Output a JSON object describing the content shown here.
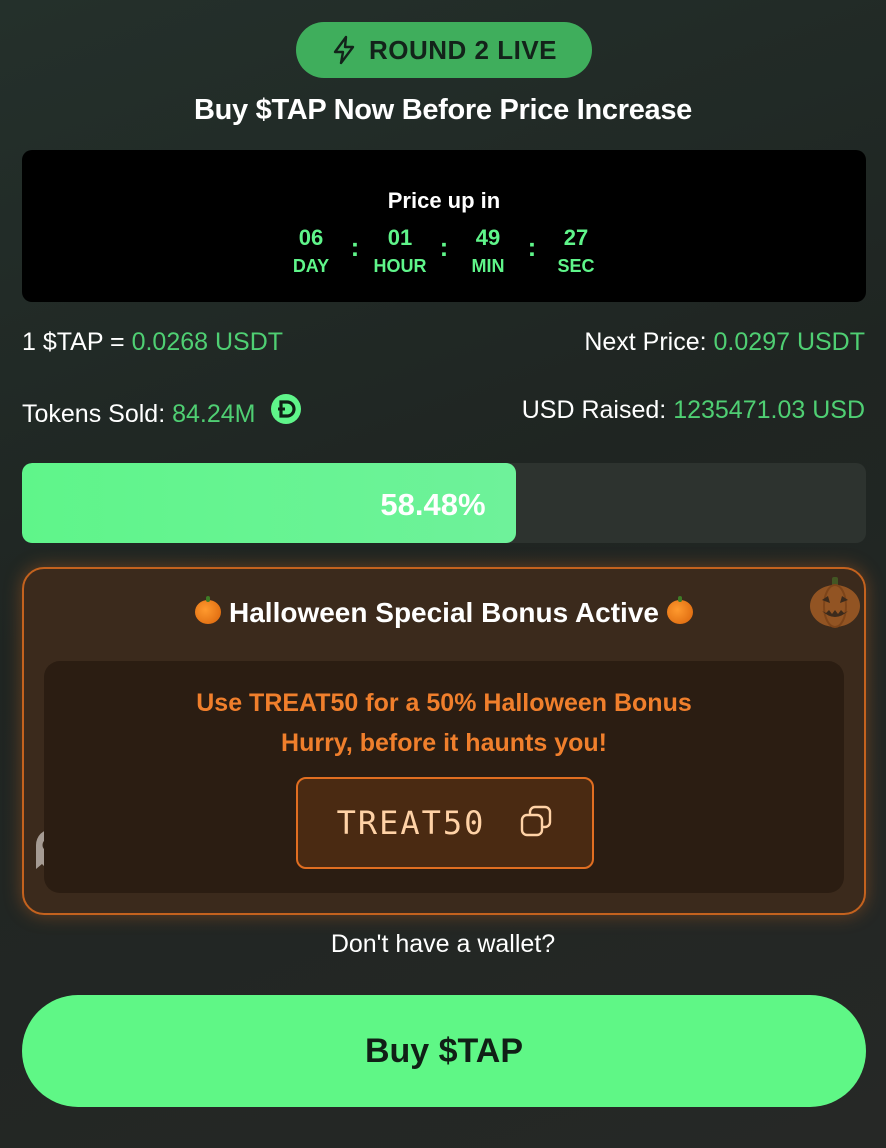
{
  "badge": {
    "icon": "lightning-icon",
    "label": "ROUND 2 LIVE"
  },
  "headline": "Buy $TAP Now Before Price Increase",
  "countdown": {
    "title": "Price up in",
    "separator": ":",
    "units": [
      {
        "value": "06",
        "label": "DAY"
      },
      {
        "value": "01",
        "label": "HOUR"
      },
      {
        "value": "49",
        "label": "MIN"
      },
      {
        "value": "27",
        "label": "SEC"
      }
    ]
  },
  "stats": {
    "price_label": "1 $TAP = ",
    "price_value": "0.0268 USDT",
    "next_price_label": "Next Price: ",
    "next_price_value": "0.0297 USDT",
    "tokens_sold_label": "Tokens Sold: ",
    "tokens_sold_value": "84.24M",
    "tokens_icon": "d-coin-icon",
    "usd_raised_label": "USD Raised: ",
    "usd_raised_value": "1235471.03 USD"
  },
  "progress": {
    "fraction": 0.5848,
    "text": "58.48%"
  },
  "promo": {
    "title": "Halloween Special Bonus Active",
    "title_icon": "pumpkin-icon",
    "line1": "Use TREAT50 for a 50% Halloween Bonus",
    "line2": "Hurry, before it haunts you!",
    "code": "TREAT50",
    "copy_icon": "copy-icon",
    "decorations": [
      "pumpkin-icon",
      "ghost-icon"
    ]
  },
  "wallet_prompt": "Don't have a wallet?",
  "buy_button": "Buy $TAP",
  "colors": {
    "accent_green": "#5ff58a",
    "value_green": "#4fcf73",
    "badge_green": "#3fae5c",
    "promo_orange": "#f07f2c",
    "promo_border": "#c4621e"
  }
}
